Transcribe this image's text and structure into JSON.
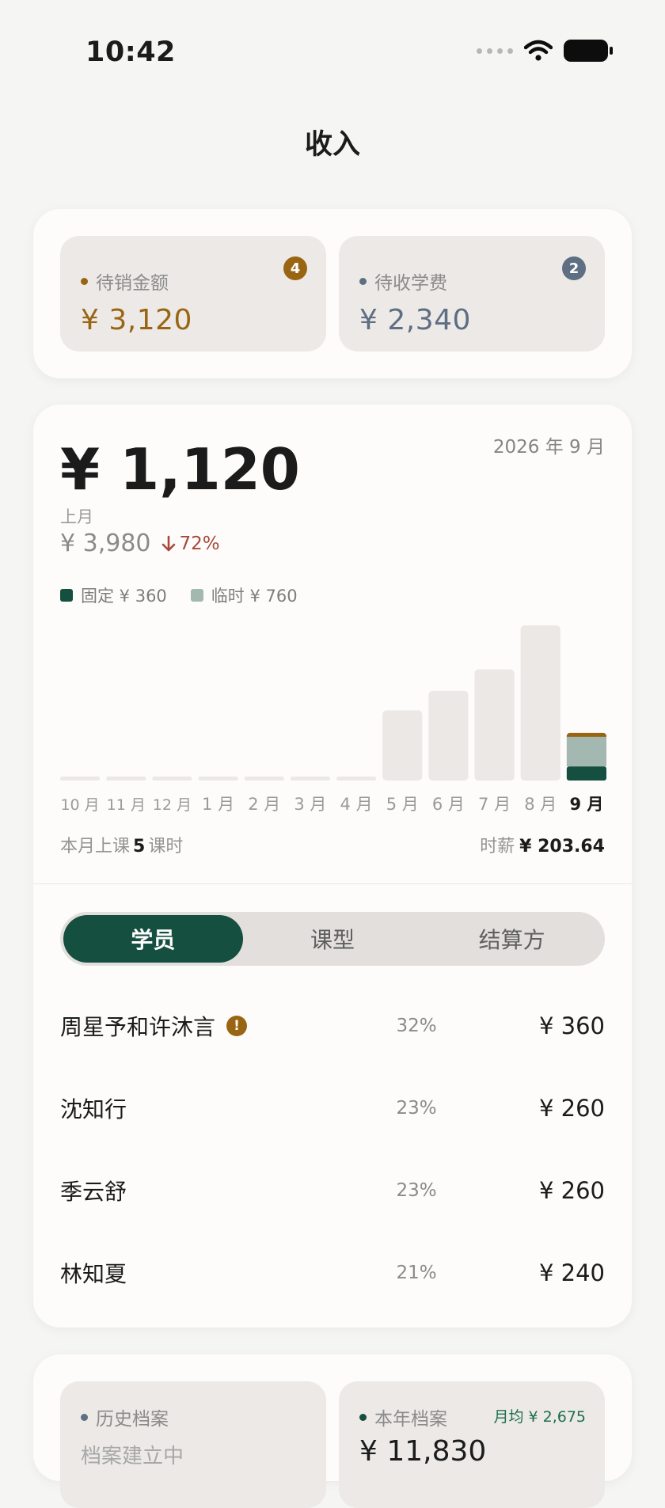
{
  "status_bar": {
    "time": "10:42"
  },
  "header": {
    "title": "收入"
  },
  "pending": {
    "left": {
      "label": "待销金额",
      "badge": "4",
      "amount": "¥ 3,120",
      "color": "#9a6513"
    },
    "right": {
      "label": "待收学费",
      "badge": "2",
      "amount": "¥ 2,340",
      "color": "#5e6f83"
    }
  },
  "summary": {
    "amount": "¥ 1,120",
    "month": "2026 年 9 月",
    "prev_label": "上月",
    "prev_amount": "¥ 3,980",
    "change": "72%",
    "legend": [
      {
        "label": "固定 ¥ 360",
        "color": "#144f3f"
      },
      {
        "label": "临时 ¥ 760",
        "color": "#a2b8b1"
      }
    ]
  },
  "chart_data": {
    "type": "bar",
    "categories": [
      "10 月",
      "11 月",
      "12 月",
      "1 月",
      "2 月",
      "3 月",
      "4 月",
      "5 月",
      "6 月",
      "7 月",
      "8 月",
      "9 月"
    ],
    "values": [
      0,
      0,
      0,
      0,
      0,
      0,
      0,
      1800,
      2300,
      2850,
      3980,
      1120
    ],
    "current": {
      "fixed": 360,
      "temporary": 760
    },
    "ylim": [
      0,
      3980
    ]
  },
  "stats": {
    "lessons_prefix": "本月上课",
    "lessons_count": "5",
    "lessons_suffix": "课时",
    "rate_label": "时薪",
    "rate_value": "¥ 203.64"
  },
  "tabs": [
    {
      "label": "学员",
      "active": true
    },
    {
      "label": "课型",
      "active": false
    },
    {
      "label": "结算方",
      "active": false
    }
  ],
  "rows": [
    {
      "name": "周星予和许沐言",
      "warning": "!",
      "pct": "32%",
      "amount": "¥ 360"
    },
    {
      "name": "沈知行",
      "pct": "23%",
      "amount": "¥ 260"
    },
    {
      "name": "季云舒",
      "pct": "23%",
      "amount": "¥ 260"
    },
    {
      "name": "林知夏",
      "pct": "21%",
      "amount": "¥ 240"
    }
  ],
  "archives": {
    "left": {
      "label": "历史档案",
      "sub": "档案建立中"
    },
    "right": {
      "label": "本年档案",
      "extra": "月均 ¥ 2,675",
      "value": "¥ 11,830"
    }
  },
  "colors": {
    "accent": "#144f3f",
    "pending": "#9a6513",
    "neutral": "#5e6f83",
    "down": "#a8483a"
  }
}
